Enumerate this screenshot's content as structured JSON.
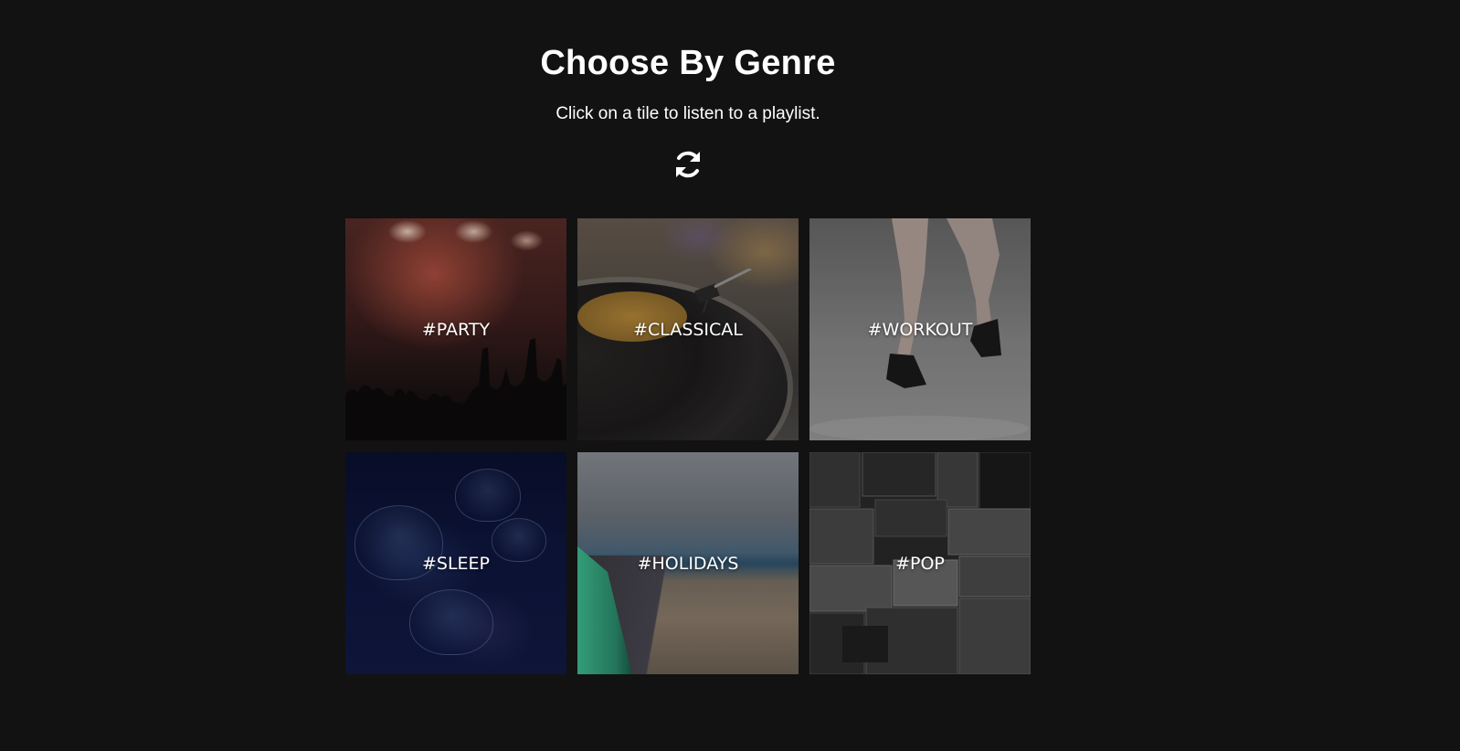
{
  "header": {
    "title": "Choose By Genre",
    "subtitle": "Click on a tile to listen to a playlist.",
    "refresh_icon": "refresh-icon"
  },
  "tiles": [
    {
      "label": "#PARTY",
      "icon": "concert-crowd-image"
    },
    {
      "label": "#CLASSICAL",
      "icon": "vinyl-record-image"
    },
    {
      "label": "#WORKOUT",
      "icon": "running-legs-image"
    },
    {
      "label": "#SLEEP",
      "icon": "jellyfish-image"
    },
    {
      "label": "#HOLIDAYS",
      "icon": "coastal-road-image"
    },
    {
      "label": "#POP",
      "icon": "amplifiers-image"
    }
  ],
  "colors": {
    "background": "#121212",
    "text": "#ffffff"
  }
}
